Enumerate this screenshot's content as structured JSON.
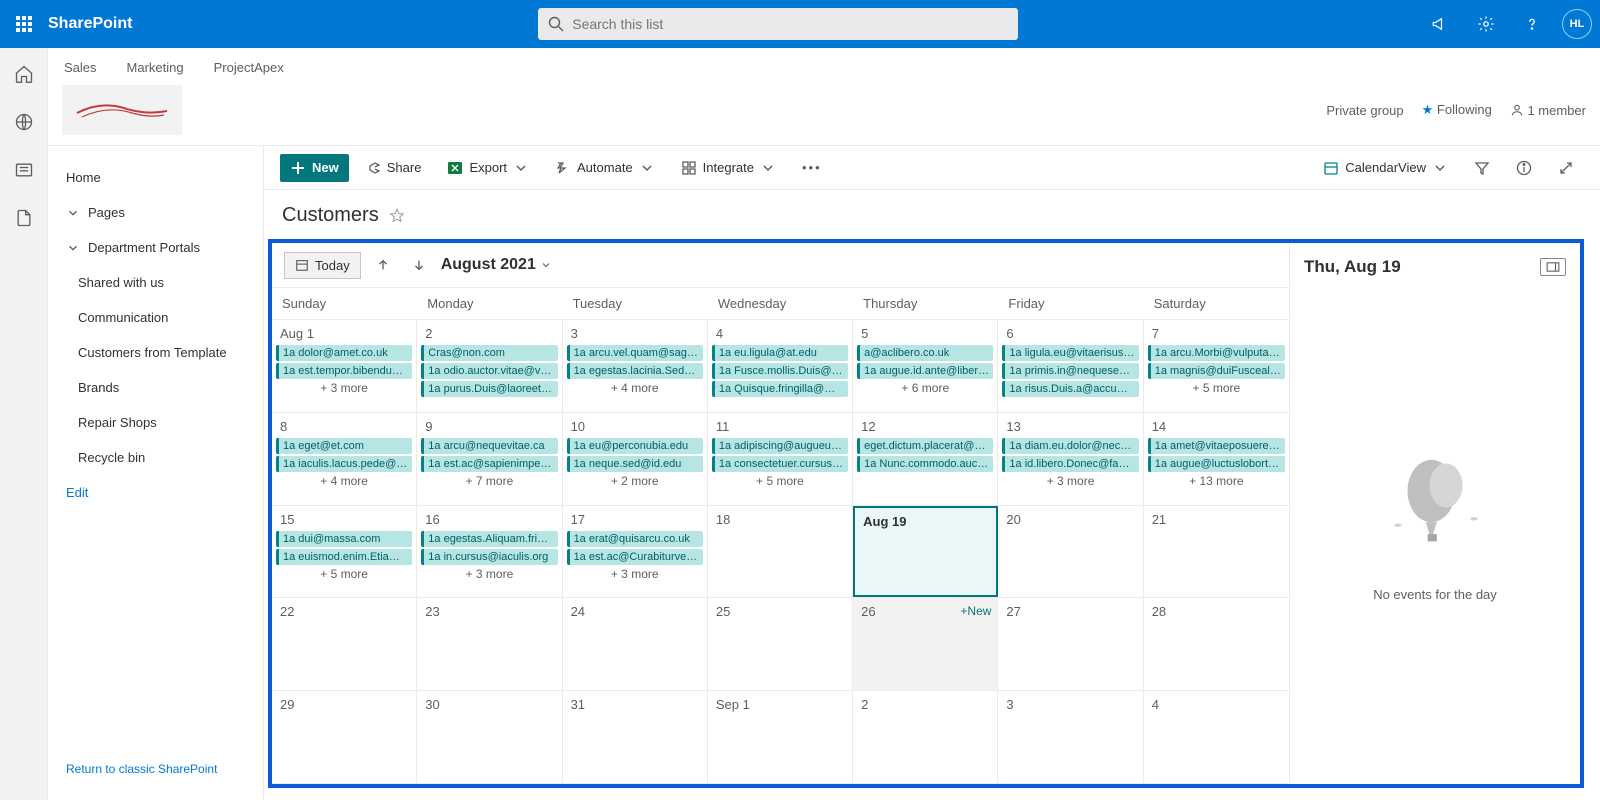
{
  "suite": {
    "app": "SharePoint",
    "search_placeholder": "Search this list",
    "avatar": "HL"
  },
  "site": {
    "links": [
      "Sales",
      "Marketing",
      "ProjectApex"
    ],
    "group_label": "Private group",
    "following": "Following",
    "members": "1 member"
  },
  "nav": {
    "home": "Home",
    "pages": "Pages",
    "dept": "Department Portals",
    "items": [
      "Shared with us",
      "Communication",
      "Customers from Template",
      "Brands",
      "Repair Shops",
      "Recycle bin"
    ],
    "edit": "Edit",
    "footer": "Return to classic SharePoint"
  },
  "cmd": {
    "new": "New",
    "share": "Share",
    "export": "Export",
    "automate": "Automate",
    "integrate": "Integrate",
    "view": "CalendarView"
  },
  "list_title": "Customers",
  "cal": {
    "today": "Today",
    "month": "August 2021",
    "dow": [
      "Sunday",
      "Monday",
      "Tuesday",
      "Wednesday",
      "Thursday",
      "Friday",
      "Saturday"
    ],
    "panel_title": "Thu, Aug 19",
    "empty_msg": "No events for the day",
    "new_label": "+New",
    "weeks": [
      [
        {
          "n": "Aug 1",
          "e": [
            "1a dolor@amet.co.uk",
            "1a est.tempor.bibendum…"
          ],
          "m": "+ 3 more"
        },
        {
          "n": "2",
          "e": [
            "Cras@non.com",
            "1a odio.auctor.vitae@vel…",
            "1a purus.Duis@laoreetips…"
          ],
          "m": null
        },
        {
          "n": "3",
          "e": [
            "1a arcu.vel.quam@sagitti…",
            "1a egestas.lacinia.Sed@ve…"
          ],
          "m": "+ 4 more"
        },
        {
          "n": "4",
          "e": [
            "1a eu.ligula@at.edu",
            "1a Fusce.mollis.Duis@orci…",
            "1a Quisque.fringilla@Mor…"
          ],
          "m": null
        },
        {
          "n": "5",
          "e": [
            "a@aclibero.co.uk",
            "1a augue.id.ante@libero…"
          ],
          "m": "+ 6 more"
        },
        {
          "n": "6",
          "e": [
            "1a ligula.eu@vitaerisus.ca",
            "1a primis.in@nequesed.org",
            "1a risus.Duis.a@accumsa…"
          ],
          "m": null
        },
        {
          "n": "7",
          "e": [
            "1a arcu.Morbi@vulputate…",
            "1a magnis@duiFuscealiqu…"
          ],
          "m": "+ 5 more"
        }
      ],
      [
        {
          "n": "8",
          "e": [
            "1a eget@et.com",
            "1a iaculis.lacus.pede@ultr…"
          ],
          "m": "+ 4 more"
        },
        {
          "n": "9",
          "e": [
            "1a arcu@nequevitae.ca",
            "1a est.ac@sapienimperi…"
          ],
          "m": "+ 7 more"
        },
        {
          "n": "10",
          "e": [
            "1a eu@perconubia.edu",
            "1a neque.sed@id.edu"
          ],
          "m": "+ 2 more"
        },
        {
          "n": "11",
          "e": [
            "1a adipiscing@augueut.ca",
            "1a consectetuer.cursus.et…"
          ],
          "m": "+ 5 more"
        },
        {
          "n": "12",
          "e": [
            "eget.dictum.placerat@ma…",
            "1a Nunc.commodo.auctor…"
          ],
          "m": null
        },
        {
          "n": "13",
          "e": [
            "1a diam.eu.dolor@necme…",
            "1a id.libero.Donec@fauci…"
          ],
          "m": "+ 3 more"
        },
        {
          "n": "14",
          "e": [
            "1a amet@vitaeposuereat…",
            "1a augue@luctuslobortis…"
          ],
          "m": "+ 13 more"
        }
      ],
      [
        {
          "n": "15",
          "e": [
            "1a dui@massa.com",
            "1a euismod.enim.Etiam@…"
          ],
          "m": "+ 5 more"
        },
        {
          "n": "16",
          "e": [
            "1a egestas.Aliquam.fringil…",
            "1a in.cursus@iaculis.org"
          ],
          "m": "+ 3 more"
        },
        {
          "n": "17",
          "e": [
            "1a erat@quisarcu.co.uk",
            "1a est.ac@Curabiturvel.co…"
          ],
          "m": "+ 3 more"
        },
        {
          "n": "18",
          "e": [],
          "m": null
        },
        {
          "n": "Aug 19",
          "e": [],
          "m": null,
          "selected": true
        },
        {
          "n": "20",
          "e": [],
          "m": null
        },
        {
          "n": "21",
          "e": [],
          "m": null
        }
      ],
      [
        {
          "n": "22",
          "e": [],
          "m": null
        },
        {
          "n": "23",
          "e": [],
          "m": null
        },
        {
          "n": "24",
          "e": [],
          "m": null
        },
        {
          "n": "25",
          "e": [],
          "m": null
        },
        {
          "n": "26",
          "e": [],
          "m": null,
          "hover": true
        },
        {
          "n": "27",
          "e": [],
          "m": null
        },
        {
          "n": "28",
          "e": [],
          "m": null
        }
      ],
      [
        {
          "n": "29",
          "e": [],
          "m": null
        },
        {
          "n": "30",
          "e": [],
          "m": null
        },
        {
          "n": "31",
          "e": [],
          "m": null
        },
        {
          "n": "Sep 1",
          "e": [],
          "m": null
        },
        {
          "n": "2",
          "e": [],
          "m": null
        },
        {
          "n": "3",
          "e": [],
          "m": null
        },
        {
          "n": "4",
          "e": [],
          "m": null
        }
      ]
    ]
  }
}
